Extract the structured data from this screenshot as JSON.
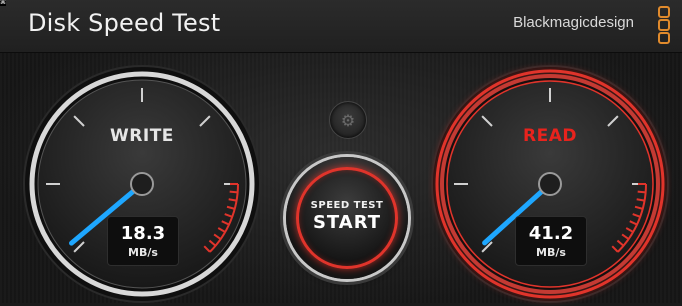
{
  "app": {
    "title": "Disk Speed Test",
    "brand": "Blackmagicdesign",
    "corner_glyph": "⌘"
  },
  "gauges": {
    "write": {
      "label": "WRITE",
      "value": "18.3",
      "unit": "MB/s",
      "label_color": "#e6e6e6",
      "needle_color": "#1ea7ff",
      "active": false
    },
    "read": {
      "label": "READ",
      "value": "41.2",
      "unit": "MB/s",
      "label_color": "#e8231d",
      "needle_color": "#1ea7ff",
      "active": true
    }
  },
  "controls": {
    "settings_icon": "gear-icon",
    "start": {
      "line1": "SPEED TEST",
      "line2": "START"
    }
  },
  "colors": {
    "accent_red": "#e0342b",
    "brand_orange": "#e08a2c",
    "needle_blue": "#1ea7ff"
  }
}
